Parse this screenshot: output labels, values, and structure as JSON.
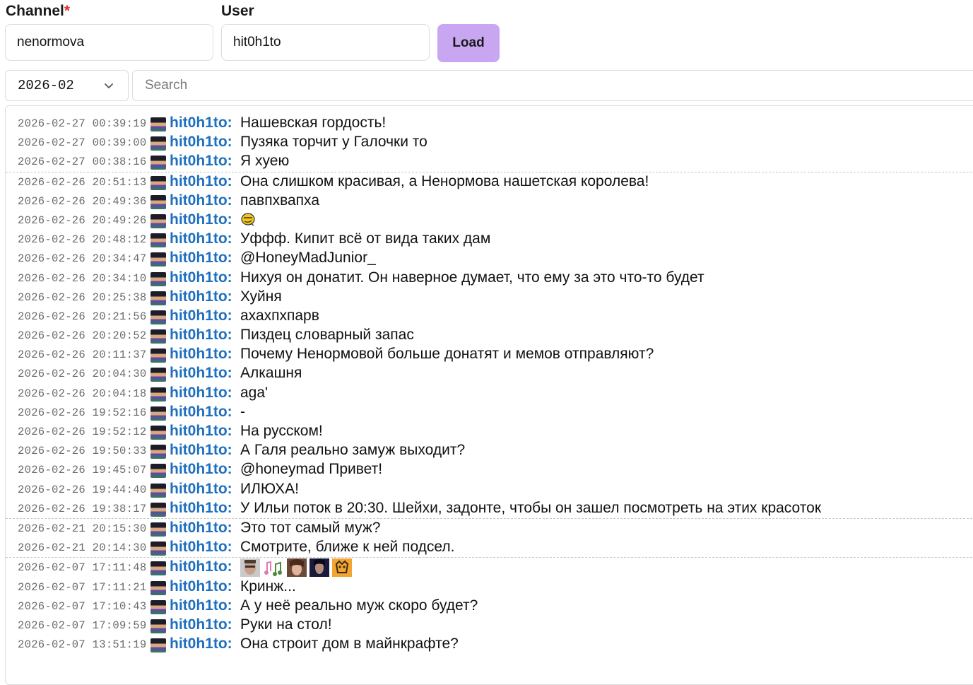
{
  "form": {
    "channel_label": "Channel",
    "channel_required": "*",
    "channel_value": "nenormova",
    "user_label": "User",
    "user_value": "hit0h1to",
    "load_label": "Load"
  },
  "filters": {
    "month_value": "2026-02",
    "search_placeholder": "Search"
  },
  "colors": {
    "accent": "#c9a6f2",
    "username": "#1e6fbf"
  },
  "messages": [
    {
      "ts": "2026-02-27 00:39:19",
      "user": "hit0h1to:",
      "text": "Нашевская гордость!"
    },
    {
      "ts": "2026-02-27 00:39:00",
      "user": "hit0h1to:",
      "text": "Пузяка торчит у Галочки то"
    },
    {
      "ts": "2026-02-27 00:38:16",
      "user": "hit0h1to:",
      "text": "Я хуею"
    },
    {
      "ts": "2026-02-26 20:51:13",
      "user": "hit0h1to:",
      "text": "Она слишком красивая, а Ненормова нашетская королева!"
    },
    {
      "ts": "2026-02-26 20:49:36",
      "user": "hit0h1to:",
      "text": "павпхвапха"
    },
    {
      "ts": "2026-02-26 20:49:26",
      "user": "hit0h1to:",
      "text": "",
      "emotes": [
        "yellow-face-emote-icon"
      ]
    },
    {
      "ts": "2026-02-26 20:48:12",
      "user": "hit0h1to:",
      "text": "Уффф. Кипит всё от вида таких дам"
    },
    {
      "ts": "2026-02-26 20:34:47",
      "user": "hit0h1to:",
      "text": "@HoneyMadJunior_"
    },
    {
      "ts": "2026-02-26 20:34:10",
      "user": "hit0h1to:",
      "text": "Нихуя он донатит. Он наверное думает, что ему за это что-то будет"
    },
    {
      "ts": "2026-02-26 20:25:38",
      "user": "hit0h1to:",
      "text": "Хуйня"
    },
    {
      "ts": "2026-02-26 20:21:56",
      "user": "hit0h1to:",
      "text": "ахахпхпарв"
    },
    {
      "ts": "2026-02-26 20:20:52",
      "user": "hit0h1to:",
      "text": "Пиздец словарный запас"
    },
    {
      "ts": "2026-02-26 20:11:37",
      "user": "hit0h1to:",
      "text": "Почему Ненормовой больше донатят и мемов отправляют?"
    },
    {
      "ts": "2026-02-26 20:04:30",
      "user": "hit0h1to:",
      "text": "Алкашня"
    },
    {
      "ts": "2026-02-26 20:04:18",
      "user": "hit0h1to:",
      "text": "aga'"
    },
    {
      "ts": "2026-02-26 19:52:16",
      "user": "hit0h1to:",
      "text": "-"
    },
    {
      "ts": "2026-02-26 19:52:12",
      "user": "hit0h1to:",
      "text": "На русском!"
    },
    {
      "ts": "2026-02-26 19:50:33",
      "user": "hit0h1to:",
      "text": "А Галя реально замуж выходит?"
    },
    {
      "ts": "2026-02-26 19:45:07",
      "user": "hit0h1to:",
      "text": "@honeymad Привет!"
    },
    {
      "ts": "2026-02-26 19:44:40",
      "user": "hit0h1to:",
      "text": "ИЛЮХА!"
    },
    {
      "ts": "2026-02-26 19:38:17",
      "user": "hit0h1to:",
      "text": "У Ильи поток в 20:30. Шейхи, задонте, чтобы он зашел посмотреть на этих красоток"
    },
    {
      "ts": "2026-02-21 20:15:30",
      "user": "hit0h1to:",
      "text": "Это тот самый муж?"
    },
    {
      "ts": "2026-02-21 20:14:30",
      "user": "hit0h1to:",
      "text": "Смотрите, ближе к ней подсел."
    },
    {
      "ts": "2026-02-07 17:11:48",
      "user": "hit0h1to:",
      "text": "",
      "emotes": [
        "face-emote-icon",
        "music-notes-emote-icon",
        "girl-face-emote-icon",
        "dark-face-emote-icon",
        "orange-creature-emote-icon"
      ]
    },
    {
      "ts": "2026-02-07 17:11:21",
      "user": "hit0h1to:",
      "text": "Кринж..."
    },
    {
      "ts": "2026-02-07 17:10:43",
      "user": "hit0h1to:",
      "text": "А у неё реально муж скоро будет?"
    },
    {
      "ts": "2026-02-07 17:09:59",
      "user": "hit0h1to:",
      "text": "Руки на стол!"
    },
    {
      "ts": "2026-02-07 13:51:19",
      "user": "hit0h1to:",
      "text": "Она строит дом в майнкрафте?"
    }
  ]
}
